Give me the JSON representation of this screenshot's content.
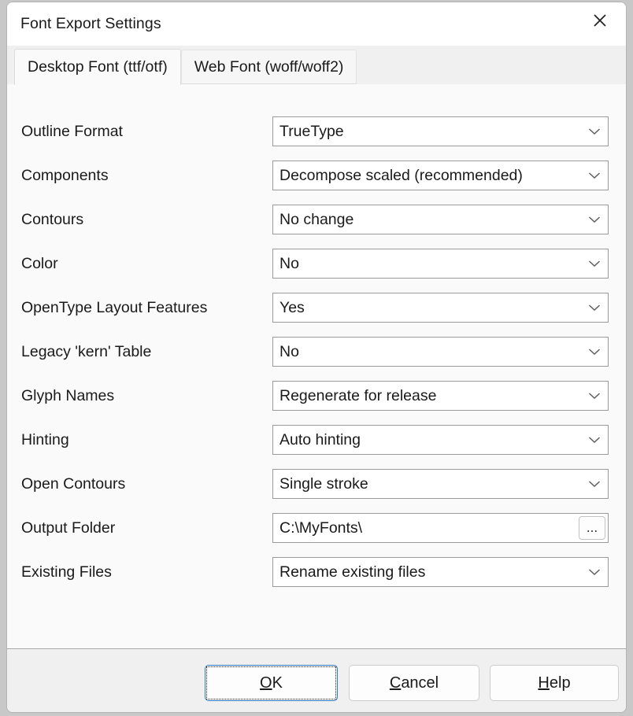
{
  "window": {
    "title": "Font Export Settings",
    "close_icon": "close-icon"
  },
  "tabs": [
    {
      "label": "Desktop Font (ttf/otf)",
      "active": true
    },
    {
      "label": "Web Font (woff/woff2)",
      "active": false
    }
  ],
  "form": {
    "rows": [
      {
        "label": "Outline Format",
        "value": "TrueType",
        "control": "dropdown"
      },
      {
        "label": "Components",
        "value": "Decompose scaled (recommended)",
        "control": "dropdown"
      },
      {
        "label": "Contours",
        "value": "No change",
        "control": "dropdown"
      },
      {
        "label": "Color",
        "value": "No",
        "control": "dropdown"
      },
      {
        "label": "OpenType Layout Features",
        "value": "Yes",
        "control": "dropdown"
      },
      {
        "label": "Legacy 'kern' Table",
        "value": "No",
        "control": "dropdown"
      },
      {
        "label": "Glyph Names",
        "value": "Regenerate for release",
        "control": "dropdown"
      },
      {
        "label": "Hinting",
        "value": "Auto hinting",
        "control": "dropdown"
      },
      {
        "label": "Open Contours",
        "value": "Single stroke",
        "control": "dropdown"
      },
      {
        "label": "Output Folder",
        "value": "C:\\MyFonts\\",
        "control": "text-with-browse",
        "browse_label": "..."
      },
      {
        "label": "Existing Files",
        "value": "Rename existing files",
        "control": "dropdown"
      }
    ]
  },
  "footer": {
    "buttons": [
      {
        "name": "ok",
        "accelerator": "O",
        "rest": "K",
        "focused": true
      },
      {
        "name": "cancel",
        "accelerator": "C",
        "rest": "ancel",
        "focused": false
      },
      {
        "name": "help",
        "accelerator": "H",
        "rest": "elp",
        "focused": false
      }
    ]
  },
  "colors": {
    "focus_border": "#2f7ac4",
    "window_bg": "#fafafa",
    "footer_bg": "#f0f0f0",
    "tabstrip_bg": "#f0f0f0"
  }
}
